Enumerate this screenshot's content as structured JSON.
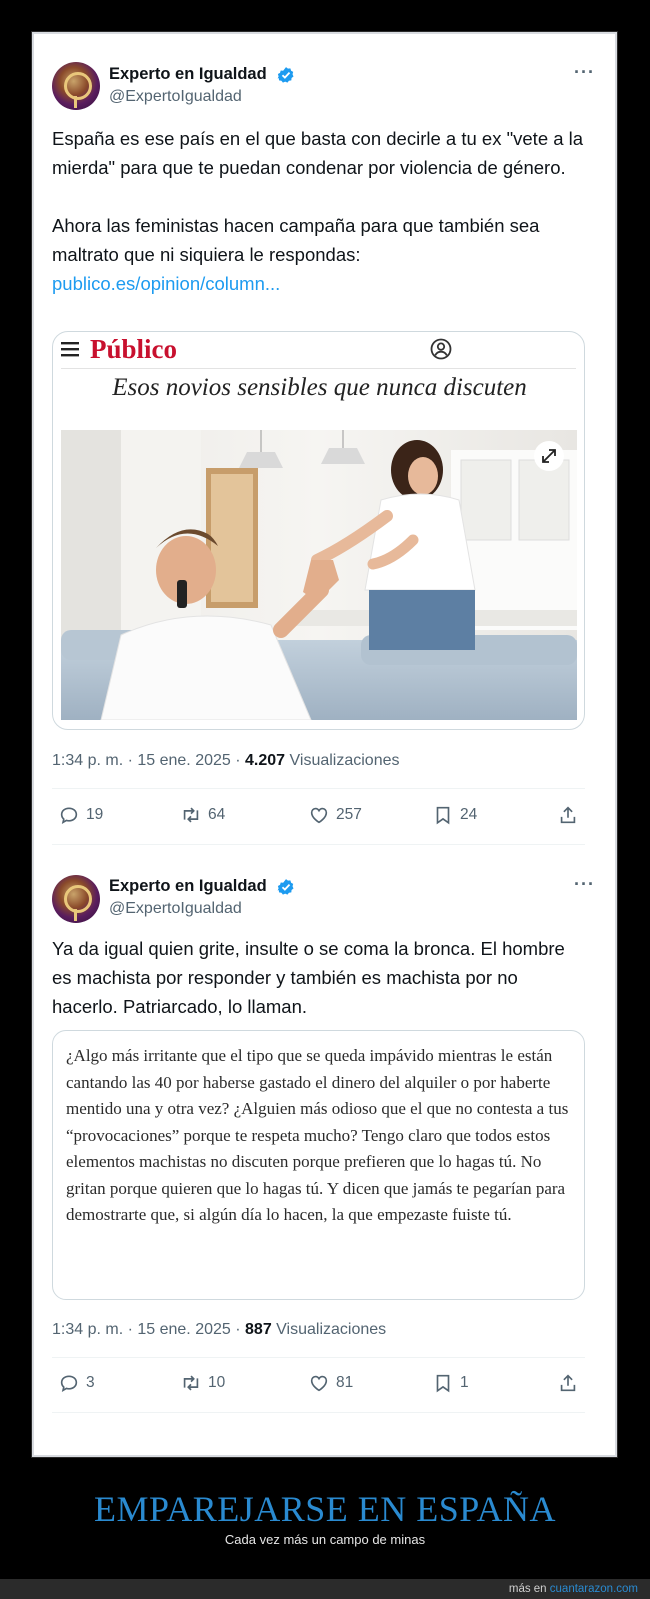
{
  "tweet1": {
    "author_name": "Experto en Igualdad",
    "author_handle": "@ExpertoIgualdad",
    "more": "···",
    "text_p1": "España es ese país en el que basta con decirle a tu ex \"vete a la mierda\" para que te puedan condenar por violencia de género.",
    "text_p2": "Ahora las feministas hacen campaña para que también sea maltrato que ni siquiera le respondas:",
    "link": "publico.es/opinion/column...",
    "card": {
      "logo": "Público",
      "headline": "Esos novios sensibles que nunca discuten"
    },
    "time": "1:34 p. m. · 15 ene. 2025 · ",
    "views": "4.207",
    "views_label": " Visualizaciones",
    "replies": "19",
    "retweets": "64",
    "likes": "257",
    "bookmarks": "24"
  },
  "tweet2": {
    "author_name": "Experto en Igualdad",
    "author_handle": "@ExpertoIgualdad",
    "more": "···",
    "text": "Ya da igual quien grite, insulte o se coma la bronca. El hombre es machista por responder y también es machista por no hacerlo. Patriarcado, lo llaman.",
    "quote": "¿Algo más irritante que el tipo que se queda impávido mientras le están cantando las 40 por haberse gastado el dinero del alquiler o por haberte mentido una y otra vez? ¿Alguien más odioso que el que no contesta a tus “provocaciones” porque te respeta mucho? Tengo claro que todos estos elementos machistas no discuten porque prefieren que lo hagas tú. No gritan porque quieren que lo hagas tú. Y dicen que jamás te pegarían para demostrarte que, si algún día lo hacen, la que empezaste fuiste tú.",
    "time": "1:34 p. m. · 15 ene. 2025 · ",
    "views": "887",
    "views_label": " Visualizaciones",
    "replies": "3",
    "retweets": "10",
    "likes": "81",
    "bookmarks": "1"
  },
  "footer": {
    "title": "EMPAREJARSE EN ESPAÑA",
    "subtitle": "Cada vez más un campo de minas",
    "prefix": "más en ",
    "site": "cuantarazon.com"
  },
  "colors": {
    "link": "#1d9bf0",
    "verified": "#1d9bf0",
    "publico_red": "#c8102e",
    "footer_title": "#2a8ad0"
  },
  "icons": [
    "avatar",
    "verified-badge-icon",
    "more-icon",
    "reply-icon",
    "retweet-icon",
    "like-icon",
    "bookmark-icon",
    "share-icon",
    "menu-icon",
    "user-icon",
    "expand-icon"
  ]
}
